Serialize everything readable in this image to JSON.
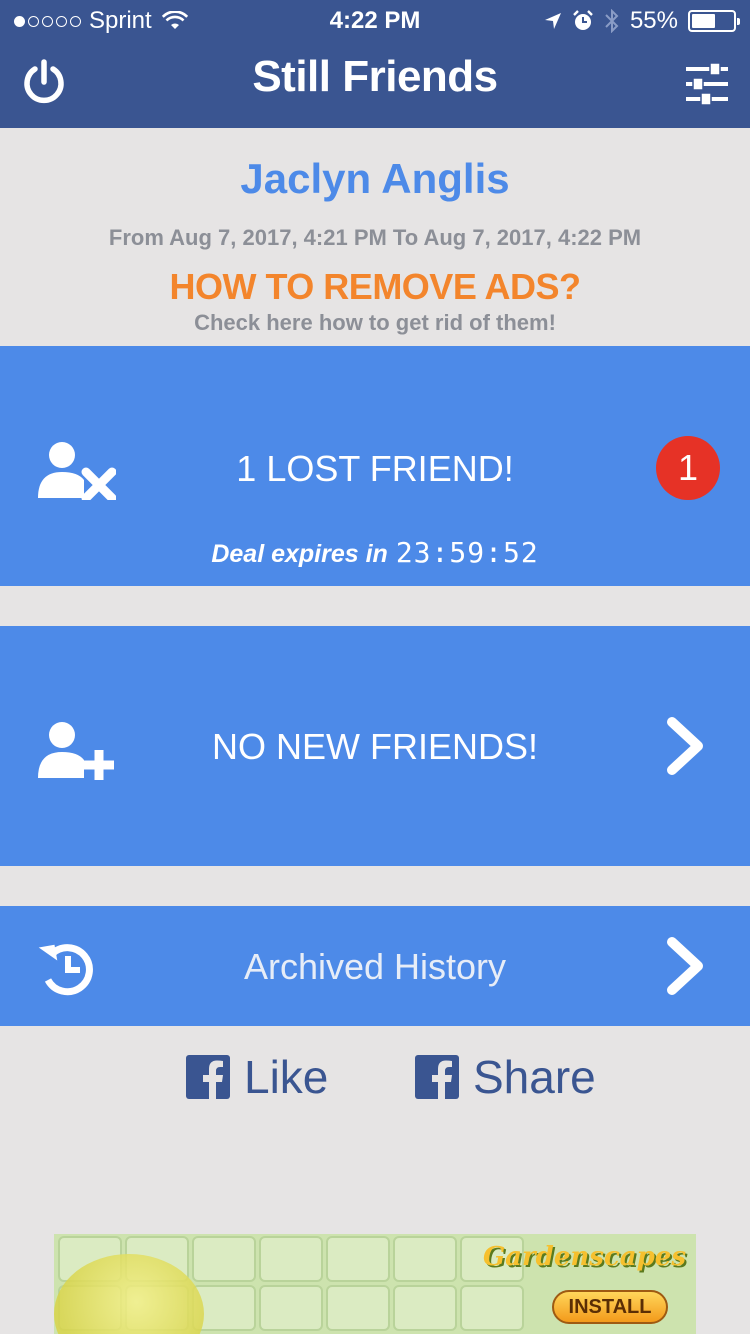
{
  "status_bar": {
    "carrier": "Sprint",
    "time": "4:22 PM",
    "battery": "55%",
    "battery_level": 0.55
  },
  "nav": {
    "title": "Still Friends",
    "left_icon": "power-icon",
    "right_icon": "sliders-icon"
  },
  "header": {
    "user_name": "Jaclyn Anglis",
    "date_range": "From Aug 7, 2017, 4:21 PM To Aug 7, 2017, 4:22 PM",
    "ads_title": "HOW TO REMOVE ADS?",
    "ads_subtitle": "Check here how to get rid of them!"
  },
  "lost_panel": {
    "label": "1 LOST FRIEND!",
    "badge": "1",
    "deal_text": "Deal expires in",
    "timer": "23:59:52",
    "icon": "user-remove-icon"
  },
  "new_panel": {
    "label": "NO NEW FRIENDS!",
    "icon": "user-add-icon"
  },
  "archive_panel": {
    "label": "Archived History",
    "icon": "history-icon"
  },
  "social": {
    "like": "Like",
    "share": "Share"
  },
  "ad": {
    "brand": "Gardenscapes",
    "cta": "INSTALL"
  },
  "colors": {
    "nav_bg": "#3a5591",
    "panel_bg": "#4d8ae8",
    "accent_orange": "#f3852c",
    "badge_red": "#e63226",
    "page_bg": "#e6e4e4"
  }
}
